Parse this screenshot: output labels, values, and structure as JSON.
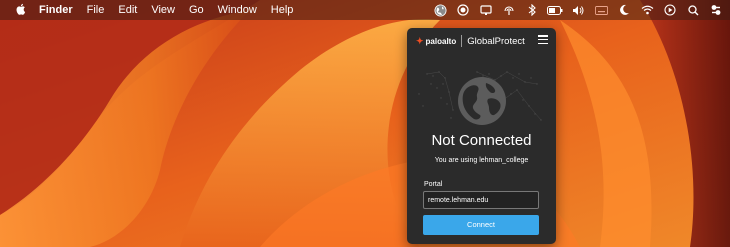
{
  "menubar": {
    "apple_icon": "apple-icon",
    "items": [
      "Finder",
      "File",
      "Edit",
      "View",
      "Go",
      "Window",
      "Help"
    ],
    "status_icons": [
      "globalprotect-icon",
      "screen-record-icon",
      "display-icon",
      "airdrop-icon",
      "bluetooth-icon",
      "battery-icon",
      "volume-icon",
      "keyboard-icon",
      "moon-icon",
      "wifi-icon",
      "play-icon",
      "search-icon",
      "control-center-icon"
    ]
  },
  "globalprotect": {
    "brand": "paloalto",
    "title": "GlobalProtect",
    "status": "Not Connected",
    "using_text": "You are using lehman_college",
    "portal_label": "Portal",
    "portal_value": "remote.lehman.edu",
    "connect_label": "Connect"
  },
  "colors": {
    "panel_bg": "#2b2b2b",
    "connect_button": "#3aa7ea",
    "brand_accent": "#f04e23",
    "wallpaper_primary": "#e8641c"
  }
}
